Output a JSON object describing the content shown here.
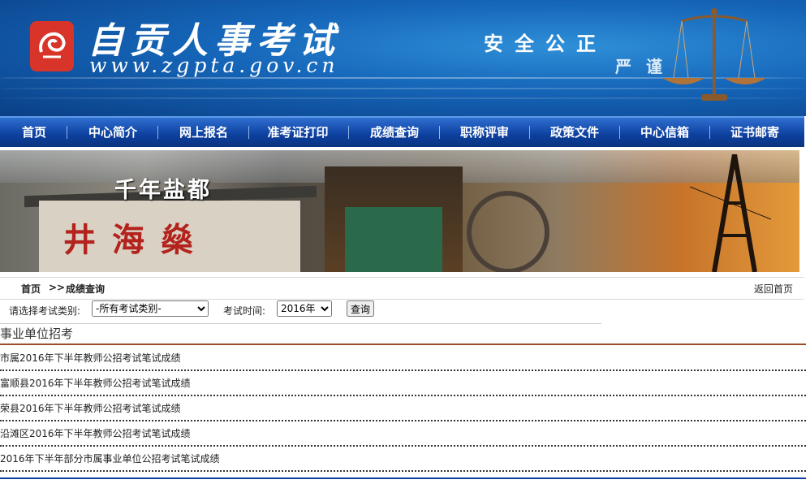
{
  "header": {
    "title": "自贡人事考试",
    "url": "www.zgpta.gov.cn",
    "motto": "安全公正",
    "motto2": "严谨"
  },
  "nav": {
    "items": [
      {
        "label": "首页"
      },
      {
        "label": "中心简介"
      },
      {
        "label": "网上报名"
      },
      {
        "label": "准考证打印"
      },
      {
        "label": "成绩查询"
      },
      {
        "label": "职称评审"
      },
      {
        "label": "政策文件"
      },
      {
        "label": "中心信箱"
      },
      {
        "label": "证书邮寄"
      }
    ]
  },
  "banner": {
    "caption": "千年盐都",
    "sign": "井海燊"
  },
  "breadcrumb": {
    "home": "首页",
    "separator": ">>",
    "current": "成绩查询",
    "back": "返回首页"
  },
  "filter": {
    "category_label": "请选择考试类别:",
    "category_value": "-所有考试类别-",
    "time_label": "考试时间:",
    "year_value": "2016年",
    "query_button": "查询"
  },
  "section": {
    "title": "事业单位招考"
  },
  "results": [
    "市属2016年下半年教师公招考试笔试成绩",
    "富顺县2016年下半年教师公招考试笔试成绩",
    "荣县2016年下半年教师公招考试笔试成绩",
    "沿滩区2016年下半年教师公招考试笔试成绩",
    "2016年下半年部分市属事业单位公招考试笔试成绩"
  ],
  "colors": {
    "nav_blue": "#0d3f9e",
    "header_blue": "#1565b8",
    "section_rule": "#9a4f2a"
  }
}
